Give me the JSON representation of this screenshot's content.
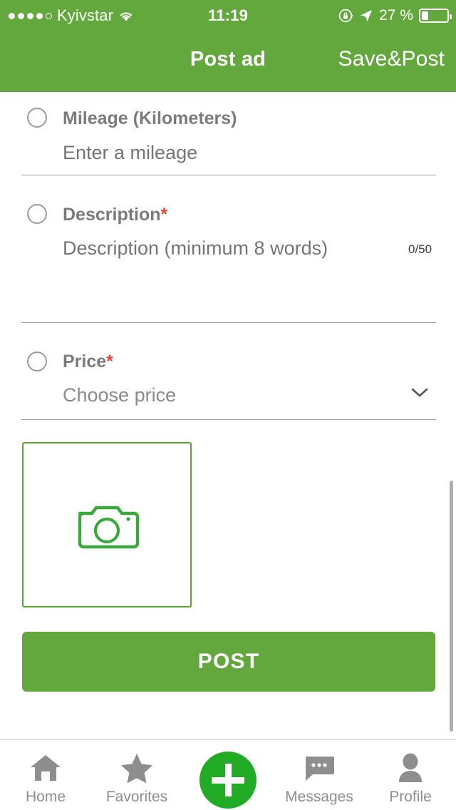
{
  "status_bar": {
    "signal_dots_filled": 4,
    "signal_dots_total": 5,
    "carrier": "Kyivstar",
    "wifi_icon": "wifi-icon",
    "time": "11:19",
    "rotation_lock_icon": "rotation-lock-icon",
    "location_icon": "location-arrow-icon",
    "battery_percent_label": "27 %",
    "battery_percent_value": 27
  },
  "nav_bar": {
    "title": "Post ad",
    "action_label": "Save&Post",
    "background": "#62a83c"
  },
  "form": {
    "fields": [
      {
        "name": "mileage",
        "label": "Mileage (Kilometers)",
        "required": false,
        "placeholder": "Enter a mileage",
        "value": ""
      },
      {
        "name": "description",
        "label": "Description",
        "required": true,
        "required_marker": "*",
        "placeholder": "Description (minimum 8 words)",
        "value": "",
        "counter": "0/50"
      },
      {
        "name": "price",
        "label": "Price",
        "required": true,
        "required_marker": "*",
        "placeholder": "Choose price",
        "value": "",
        "chevron_icon": "chevron-down-icon"
      }
    ]
  },
  "photo_upload": {
    "icon": "camera-icon",
    "border_color": "#5aa832"
  },
  "post_button": {
    "label": "POST",
    "background": "#62a83c"
  },
  "tab_bar": {
    "items": [
      {
        "name": "home",
        "icon": "home-icon",
        "label": "Home"
      },
      {
        "name": "favorites",
        "icon": "star-icon",
        "label": "Favorites"
      },
      {
        "name": "add",
        "icon": "plus-icon",
        "label": ""
      },
      {
        "name": "messages",
        "icon": "message-bubble-icon",
        "label": "Messages"
      },
      {
        "name": "profile",
        "icon": "person-icon",
        "label": "Profile"
      }
    ],
    "fab_color": "#22ab24",
    "inactive_color": "#8e8e8e"
  },
  "colors": {
    "brand_green": "#62a83c",
    "accent_green": "#22ab24",
    "required_red": "#e0483c",
    "label_gray": "#7b7b7b",
    "placeholder_gray": "#c3c3c3"
  }
}
